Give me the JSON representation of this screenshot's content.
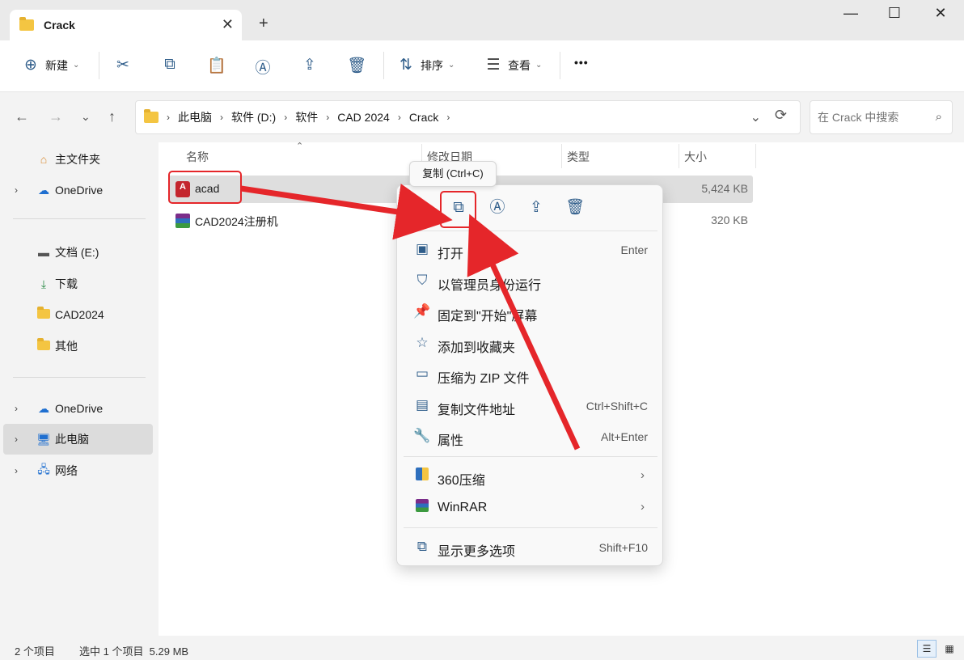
{
  "window": {
    "tab_title": "Crack",
    "tab_close": "✕",
    "new_tab": "+",
    "minimize": "—",
    "maximize": "☐",
    "close": "✕"
  },
  "toolbar": {
    "new_label": "新建",
    "sort_label": "排序",
    "view_label": "查看",
    "more": "•••"
  },
  "address": {
    "crumbs": [
      "此电脑",
      "软件 (D:)",
      "软件",
      "CAD 2024",
      "Crack"
    ],
    "search_placeholder": "在 Crack 中搜索"
  },
  "sidebar": {
    "home": "主文件夹",
    "onedrive_1": "OneDrive",
    "docs": "文档 (E:)",
    "downloads": "下载",
    "cad": "CAD2024",
    "other": "其他",
    "onedrive_2": "OneDrive",
    "this_pc": "此电脑",
    "network": "网络"
  },
  "columns": {
    "name": "名称",
    "modified": "修改日期",
    "type": "类型",
    "size": "大小"
  },
  "files": [
    {
      "name": "acad",
      "size": "5,424 KB",
      "icon": "autocad-icon"
    },
    {
      "name": "CAD2024注册机",
      "size": "320 KB",
      "icon": "winrar-archive-icon"
    }
  ],
  "tooltip": "复制 (Ctrl+C)",
  "context_menu": {
    "items": [
      {
        "label": "打开",
        "shortcut": "Enter"
      },
      {
        "label": "以管理员身份运行",
        "shortcut": ""
      },
      {
        "label": "固定到\"开始\"屏幕",
        "shortcut": ""
      },
      {
        "label": "添加到收藏夹",
        "shortcut": ""
      },
      {
        "label": "压缩为 ZIP 文件",
        "shortcut": ""
      },
      {
        "label": "复制文件地址",
        "shortcut": "Ctrl+Shift+C"
      },
      {
        "label": "属性",
        "shortcut": "Alt+Enter"
      }
    ],
    "sub_items": [
      {
        "label": "360压缩"
      },
      {
        "label": "WinRAR"
      }
    ],
    "more": {
      "label": "显示更多选项",
      "shortcut": "Shift+F10"
    }
  },
  "status": {
    "count": "2 个项目",
    "selection": "选中 1 个项目  5.29 MB"
  },
  "colors": {
    "accent": "#2f5d8a",
    "annotation_red": "#e5262a"
  }
}
